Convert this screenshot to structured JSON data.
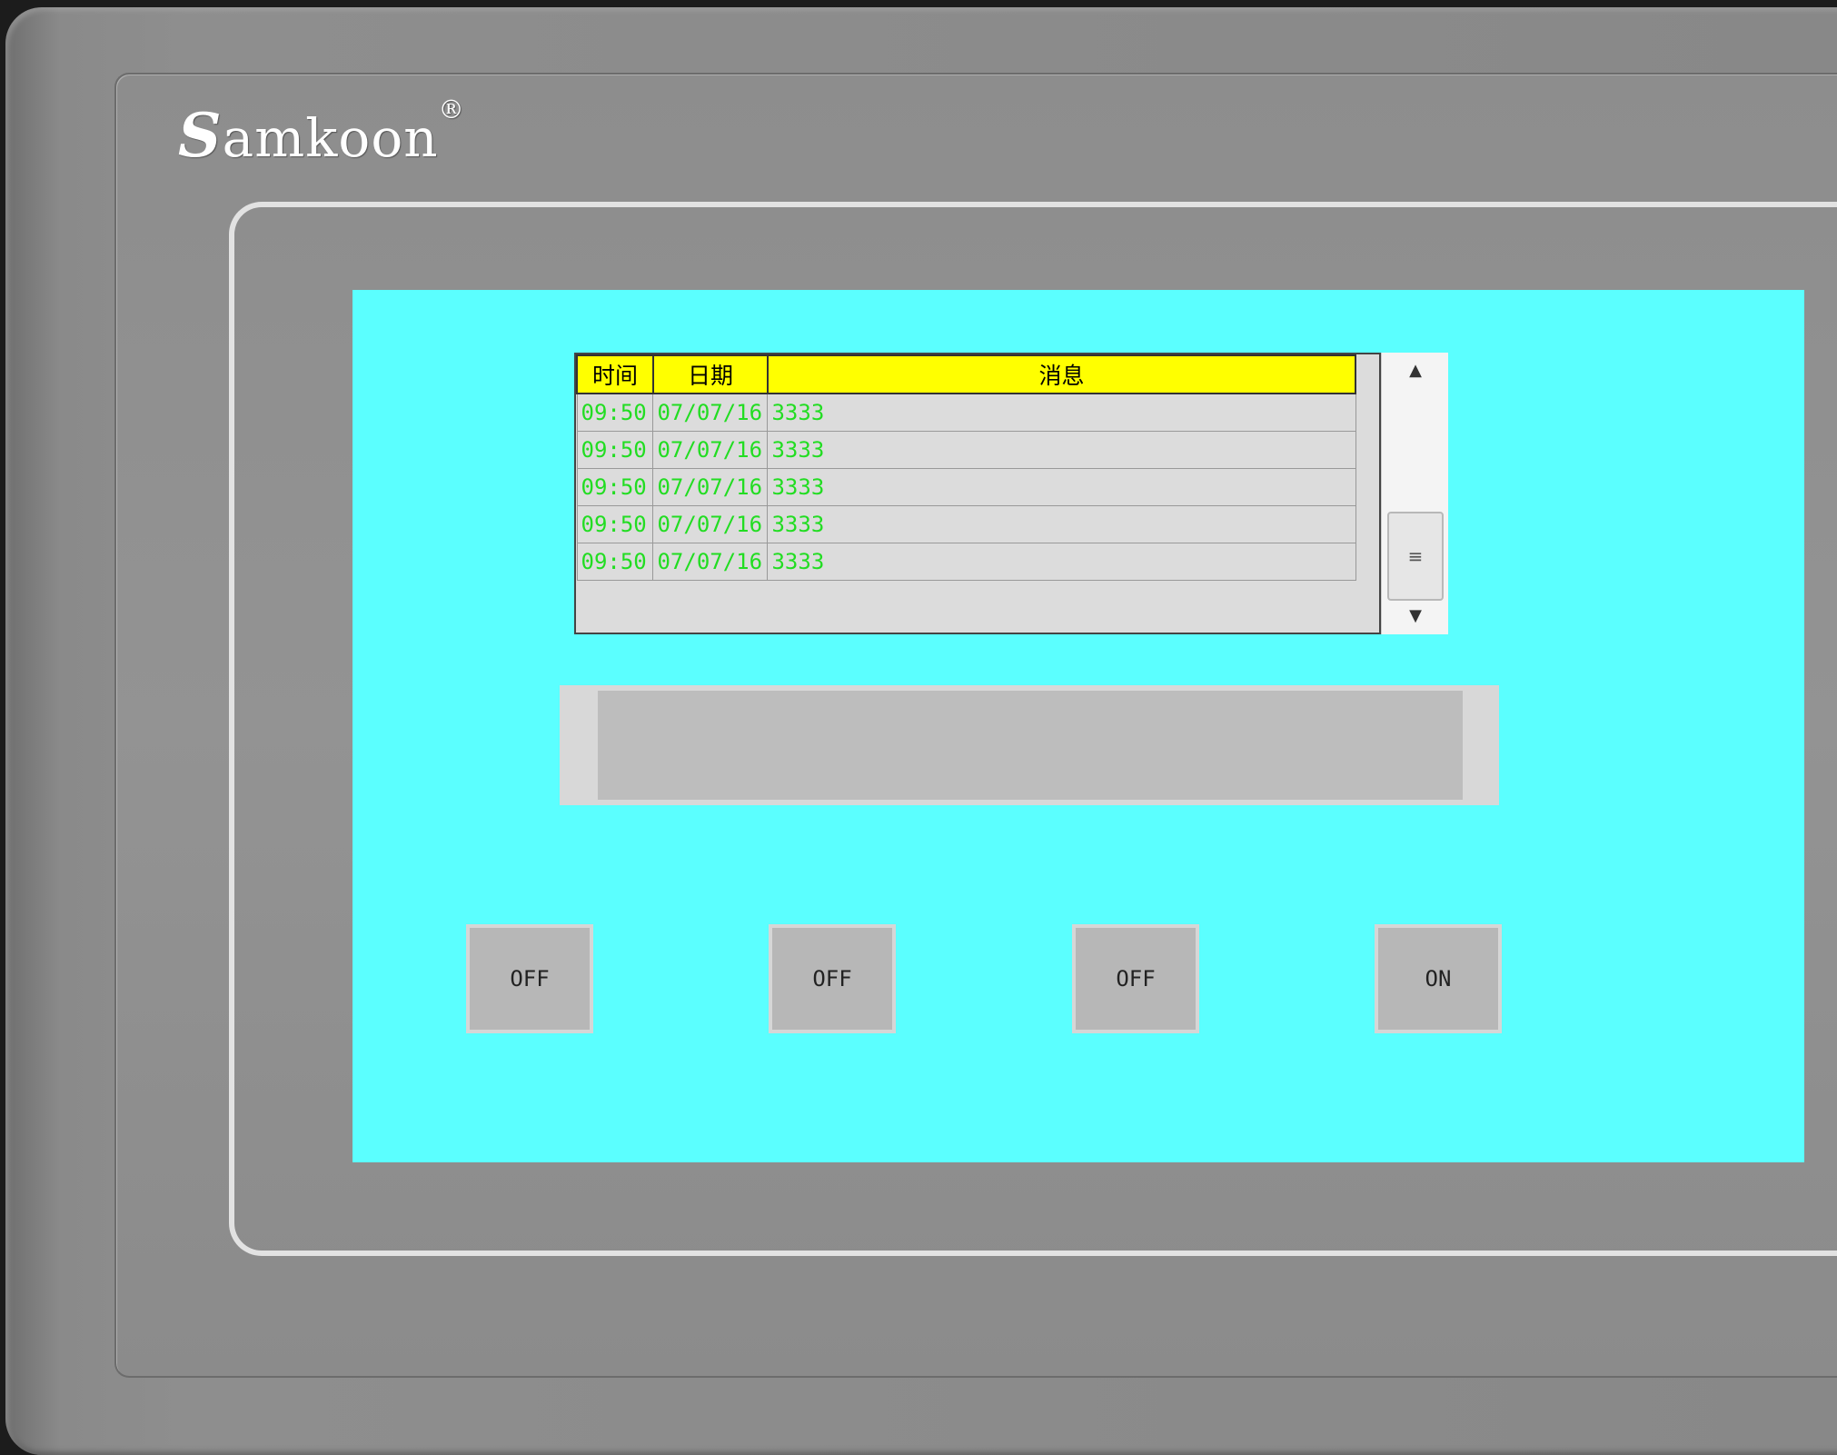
{
  "device": {
    "brand": "Samkoon",
    "brand_initial": "S",
    "brand_rest": "amkoon",
    "registered_mark": "®"
  },
  "alarm_table": {
    "headers": [
      "时间",
      "日期",
      "消息"
    ],
    "rows": [
      {
        "time": "09:50",
        "date": "07/07/16",
        "message": "3333"
      },
      {
        "time": "09:50",
        "date": "07/07/16",
        "message": "3333"
      },
      {
        "time": "09:50",
        "date": "07/07/16",
        "message": "3333"
      },
      {
        "time": "09:50",
        "date": "07/07/16",
        "message": "3333"
      },
      {
        "time": "09:50",
        "date": "07/07/16",
        "message": "3333"
      }
    ],
    "scroll_up_icon": "▲",
    "scroll_down_icon": "▼",
    "scroll_thumb_icon": "≡"
  },
  "switches": [
    {
      "label": "OFF"
    },
    {
      "label": "OFF"
    },
    {
      "label": "OFF"
    },
    {
      "label": "ON"
    }
  ],
  "colors": {
    "screen_bg": "#5bffff",
    "header_bg": "#ffff00",
    "row_text": "#22dd22"
  }
}
